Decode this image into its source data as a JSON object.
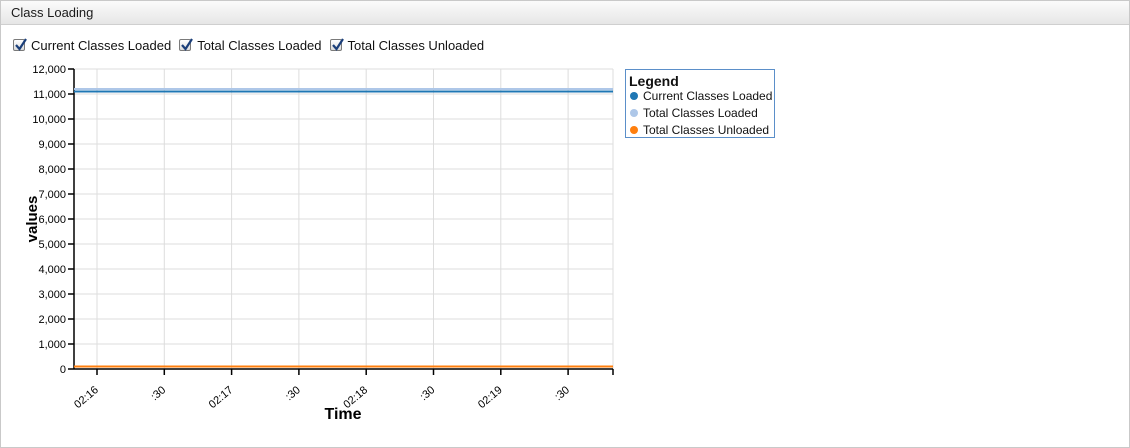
{
  "panel": {
    "title": "Class Loading"
  },
  "toggles": [
    {
      "label": "Current Classes Loaded",
      "checked": true
    },
    {
      "label": "Total Classes Loaded",
      "checked": true
    },
    {
      "label": "Total Classes Unloaded",
      "checked": true
    }
  ],
  "legend": {
    "title": "Legend",
    "items": [
      {
        "label": "Current Classes Loaded",
        "color": "#1f77b4"
      },
      {
        "label": "Total Classes Loaded",
        "color": "#aec7e8"
      },
      {
        "label": "Total Classes Unloaded",
        "color": "#ff7f0e"
      }
    ]
  },
  "chart_data": {
    "type": "line",
    "xlabel": "Time",
    "ylabel": "values",
    "ylim": [
      0,
      12000
    ],
    "yticks": [
      "0",
      "1,000",
      "2,000",
      "3,000",
      "4,000",
      "5,000",
      "6,000",
      "7,000",
      "8,000",
      "9,000",
      "10,000",
      "11,000",
      "12,000"
    ],
    "xticks": [
      "02:16",
      ":30",
      "02:17",
      ":30",
      "02:18",
      ":30",
      "02:19",
      ":30"
    ],
    "grid": true,
    "legend_position": "right",
    "series": [
      {
        "name": "Current Classes Loaded",
        "color": "#1f77b4",
        "values": [
          11100,
          11100,
          11100,
          11100,
          11100,
          11100,
          11100,
          11100
        ]
      },
      {
        "name": "Total Classes Loaded",
        "color": "#aec7e8",
        "values": [
          11200,
          11200,
          11200,
          11200,
          11200,
          11200,
          11200,
          11200
        ]
      },
      {
        "name": "Total Classes Unloaded",
        "color": "#ff7f0e",
        "values": [
          100,
          100,
          100,
          100,
          100,
          100,
          100,
          100
        ]
      }
    ]
  }
}
